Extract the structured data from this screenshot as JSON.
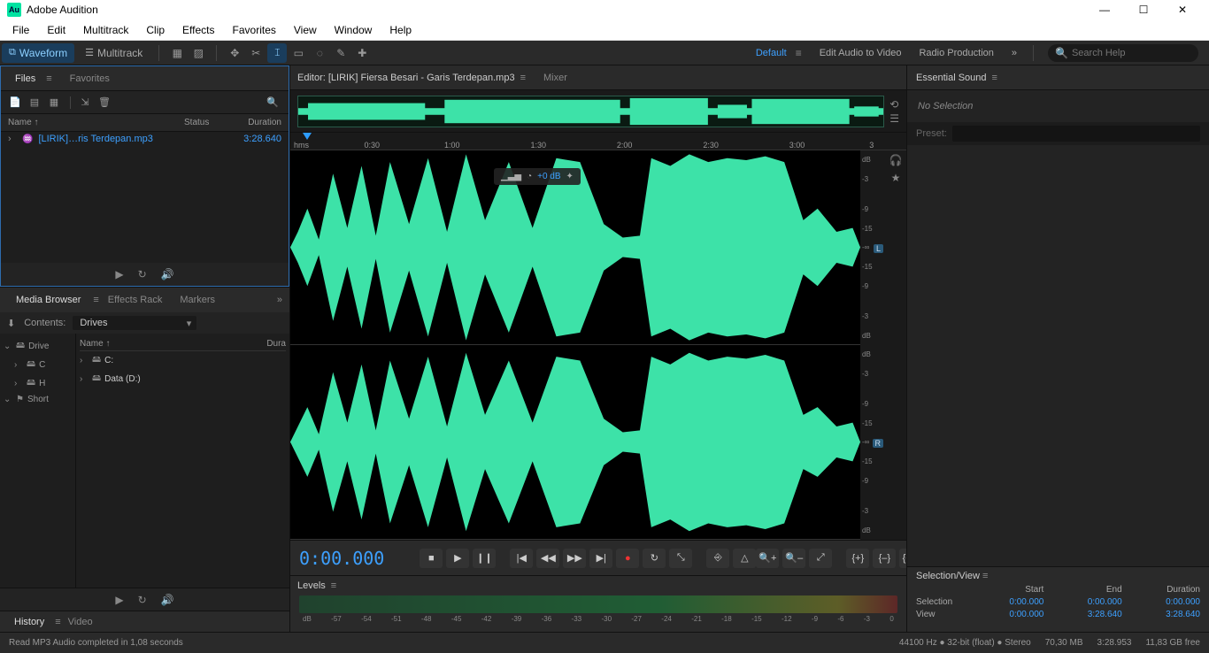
{
  "app": {
    "title": "Adobe Audition",
    "logo": "Au"
  },
  "menu": [
    "File",
    "Edit",
    "Multitrack",
    "Clip",
    "Effects",
    "Favorites",
    "View",
    "Window",
    "Help"
  ],
  "toolbar": {
    "waveform": "Waveform",
    "multitrack": "Multitrack",
    "workspaces": {
      "default": "Default",
      "editAudio": "Edit Audio to Video",
      "radio": "Radio Production"
    },
    "search_placeholder": "Search Help"
  },
  "files": {
    "tabs": {
      "files": "Files",
      "favorites": "Favorites"
    },
    "cols": {
      "name": "Name ↑",
      "status": "Status",
      "duration": "Duration"
    },
    "row": {
      "name": "[LIRIK]…ris Terdepan.mp3",
      "duration": "3:28.640"
    }
  },
  "mediaBrowser": {
    "tabs": {
      "mb": "Media Browser",
      "fx": "Effects Rack",
      "mk": "Markers"
    },
    "contents": "Contents:",
    "drives": "Drives",
    "nameCol": "Name ↑",
    "duraCol": "Dura",
    "leftTree": [
      "Drive",
      "C",
      "H",
      "Short"
    ],
    "rightTree": [
      "C:",
      "Data (D:)"
    ]
  },
  "history": {
    "history": "History",
    "video": "Video"
  },
  "editor": {
    "title": "Editor: [LIRIK] Fiersa Besari - Garis Terdepan.mp3",
    "mixer": "Mixer",
    "timeline": {
      "hms": "hms",
      "marks": [
        "0:30",
        "1:00",
        "1:30",
        "2:00",
        "2:30",
        "3:00",
        "3"
      ]
    },
    "hud": "+0 dB",
    "dbMarks": [
      "dB",
      "-3",
      "",
      "-9",
      "-15",
      "-∞",
      "-15",
      "-9",
      "",
      "-3",
      "dB"
    ],
    "chL": "L",
    "chR": "R"
  },
  "transport": {
    "time": "0:00.000"
  },
  "levels": {
    "title": "Levels",
    "marks": [
      "dB",
      "-57",
      "-54",
      "-51",
      "-48",
      "-45",
      "-42",
      "-39",
      "-36",
      "-33",
      "-30",
      "-27",
      "-24",
      "-21",
      "-18",
      "-15",
      "-12",
      "-9",
      "-6",
      "-3",
      "0"
    ]
  },
  "essential": {
    "title": "Essential Sound",
    "nosel": "No Selection",
    "preset": "Preset:"
  },
  "selview": {
    "title": "Selection/View",
    "cols": [
      "Start",
      "End",
      "Duration"
    ],
    "rows": {
      "selection": {
        "label": "Selection",
        "start": "0:00.000",
        "end": "0:00.000",
        "dur": "0:00.000"
      },
      "view": {
        "label": "View",
        "start": "0:00.000",
        "end": "3:28.640",
        "dur": "3:28.640"
      }
    }
  },
  "status": {
    "left": "Read MP3 Audio completed in 1,08 seconds",
    "right": [
      "44100 Hz ● 32-bit (float) ● Stereo",
      "70,30 MB",
      "3:28.953",
      "11,83 GB free"
    ]
  }
}
